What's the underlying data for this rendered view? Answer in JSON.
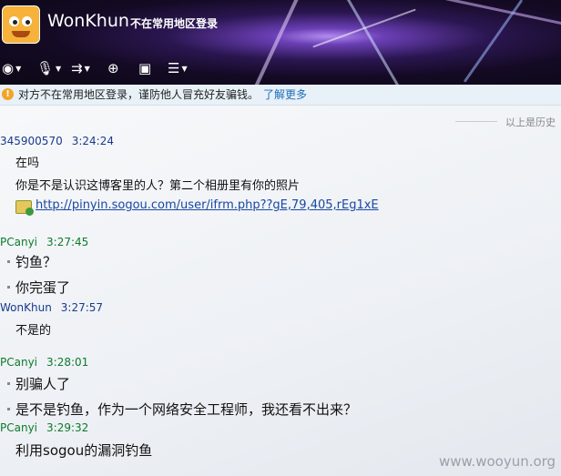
{
  "header": {
    "contact_name": "WonKhun",
    "status": "不在常用地区登录",
    "toolbar": [
      {
        "icon": "camera-icon",
        "dropdown": true
      },
      {
        "icon": "microphone-icon",
        "dropdown": true
      },
      {
        "icon": "file-transfer-icon",
        "dropdown": true
      },
      {
        "icon": "add-contact-icon",
        "dropdown": false
      },
      {
        "icon": "screen-share-icon",
        "dropdown": false
      },
      {
        "icon": "apps-menu-icon",
        "dropdown": true
      }
    ]
  },
  "warning": {
    "icon": "warning-icon",
    "text": "对方不在常用地区登录，谨防他人冒充好友骗钱。",
    "link": "了解更多"
  },
  "history_label": "以上是历史",
  "messages": [
    {
      "sender": "345900570",
      "time": "3:24:24",
      "sender_color": "blue",
      "lines": [
        "在吗",
        "你是不是认识这博客里的人？第二个相册里有你的照片"
      ],
      "url": "http://pinyin.sogou.com/user/ifrm.php??gE,79,405,rEg1xE"
    },
    {
      "sender": "PCanyi",
      "time": "3:27:45",
      "sender_color": "green",
      "lines": [
        "钓鱼？",
        "你完蛋了"
      ]
    },
    {
      "sender": "WonKhun",
      "time": "3:27:57",
      "sender_color": "blue",
      "lines": [
        "不是的"
      ]
    },
    {
      "sender": "PCanyi",
      "time": "3:28:01",
      "sender_color": "green",
      "lines": [
        "别骗人了",
        "是不是钓鱼，作为一个网络安全工程师，我还看不出来？"
      ]
    },
    {
      "sender": "PCanyi",
      "time": "3:29:32",
      "sender_color": "green",
      "lines": [
        "利用sogou的漏洞钓鱼"
      ]
    }
  ],
  "watermark": "www.wooyun.org",
  "colors": {
    "header_bg": "#140a24",
    "link": "#1947a3",
    "green_sender": "#0d7a2c",
    "blue_sender": "#1a3a8c",
    "warning": "#f3a427"
  }
}
